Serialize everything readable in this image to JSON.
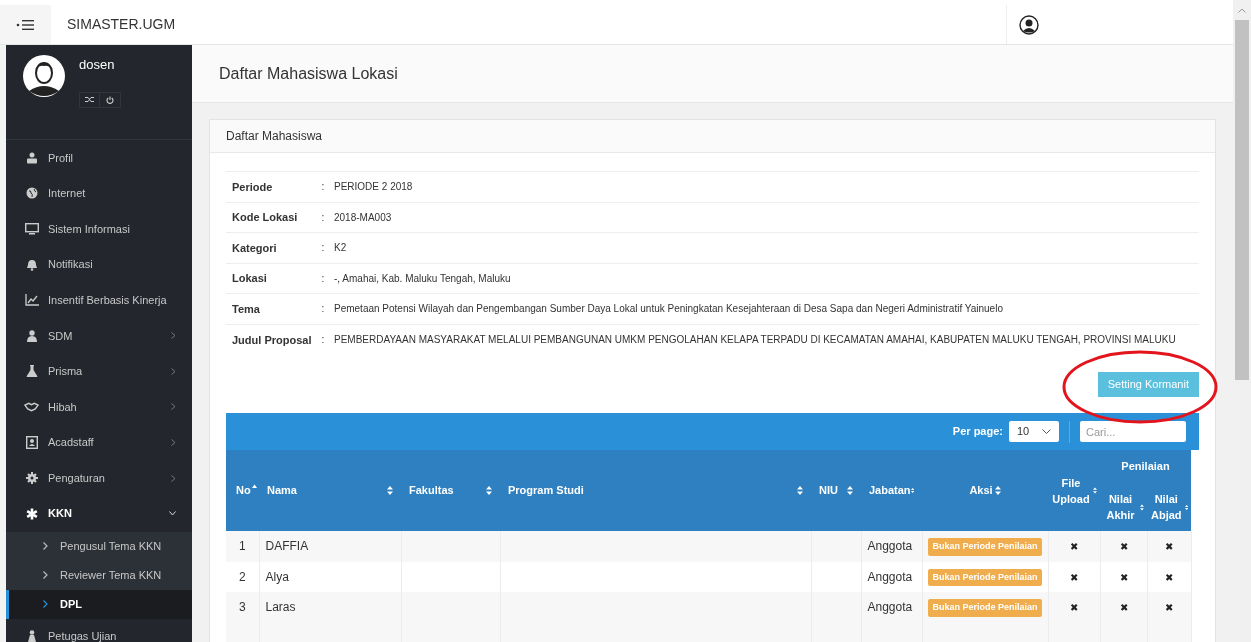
{
  "topbar": {
    "brand": "SIMASTER.UGM"
  },
  "sidebar": {
    "user": {
      "name": "dosen"
    },
    "items": [
      {
        "label": "Profil",
        "kind": "link"
      },
      {
        "label": "Internet",
        "kind": "link"
      },
      {
        "label": "Sistem Informasi",
        "kind": "link"
      },
      {
        "label": "Notifikasi",
        "kind": "link"
      },
      {
        "label": "Insentif Berbasis Kinerja",
        "kind": "link"
      },
      {
        "label": "SDM",
        "kind": "group",
        "expanded": false
      },
      {
        "label": "Prisma",
        "kind": "group",
        "expanded": false
      },
      {
        "label": "Hibah",
        "kind": "group",
        "expanded": false
      },
      {
        "label": "Acadstaff",
        "kind": "group",
        "expanded": false
      },
      {
        "label": "Pengaturan",
        "kind": "group",
        "expanded": false
      },
      {
        "label": "KKN",
        "kind": "group",
        "expanded": true,
        "children": [
          {
            "label": "Pengusul Tema KKN",
            "selected": false
          },
          {
            "label": "Reviewer Tema KKN",
            "selected": false
          },
          {
            "label": "DPL",
            "selected": true
          }
        ]
      },
      {
        "label": "Petugas Ujian",
        "kind": "link"
      }
    ]
  },
  "page_title": "Daftar Mahasiswa Lokasi",
  "card": {
    "title": "Daftar Mahasiswa",
    "details": [
      {
        "label": "Periode",
        "separator": ":",
        "value": "PERIODE 2 2018"
      },
      {
        "label": "Kode Lokasi",
        "separator": ":",
        "value": "2018-MA003"
      },
      {
        "label": "Kategori",
        "separator": ":",
        "value": "K2"
      },
      {
        "label": "Lokasi",
        "separator": ":",
        "value": "-, Amahai, Kab. Maluku Tengah, Maluku"
      },
      {
        "label": "Tema",
        "separator": ":",
        "value": "Pemetaan Potensi Wilayah dan Pengembangan Sumber Daya Lokal untuk Peningkatan Kesejahteraan di Desa Sapa dan Negeri Administratif Yainuelo"
      },
      {
        "label": "Judul Proposal",
        "separator": ":",
        "value": "PEMBERDAYAAN MASYARAKAT MELALUI PEMBANGUNAN UMKM PENGOLAHAN KELAPA TERPADU DI KECAMATAN AMAHAI, KABUPATEN MALUKU TENGAH, PROVINSI MALUKU"
      }
    ],
    "button": "Setting Kormanit",
    "annotations": [
      {
        "kind": "ellipse",
        "color": "#e3141c"
      }
    ],
    "table": {
      "per_page_label": "Per page:",
      "per_page": "10",
      "search": {
        "placeholder": "Cari..."
      },
      "group_heading": "Penilaian",
      "columns": [
        {
          "label": "No",
          "sorted": true
        },
        {
          "label": "Nama",
          "sorted": false
        },
        {
          "label": "Fakultas",
          "sorted": false
        },
        {
          "label": "Program Studi",
          "sorted": false
        },
        {
          "label": "NIU",
          "sorted": false
        },
        {
          "label": "Jabatan",
          "sorted": false
        },
        {
          "label": "Aksi",
          "sorted": false
        },
        {
          "label": "File Upload",
          "sorted": false
        },
        {
          "label": "Nilai Akhir",
          "sorted": false
        },
        {
          "label": "Nilai Abjad",
          "sorted": false
        }
      ],
      "rows": [
        {
          "no": "1",
          "nama": "DAFFIA",
          "jabatan": "Anggota",
          "aksi": "Bukan Periode Penilaian",
          "file_upload": "✖",
          "nilai_akhir": "✖",
          "nilai_abjad": "✖"
        },
        {
          "no": "2",
          "nama": "Alya",
          "jabatan": "Anggota",
          "aksi": "Bukan Periode Penilaian",
          "file_upload": "✖",
          "nilai_akhir": "✖",
          "nilai_abjad": "✖"
        },
        {
          "no": "3",
          "nama": "Laras",
          "jabatan": "Anggota",
          "aksi": "Bukan Periode Penilaian",
          "file_upload": "✖",
          "nilai_akhir": "✖",
          "nilai_abjad": "✖"
        }
      ]
    }
  }
}
